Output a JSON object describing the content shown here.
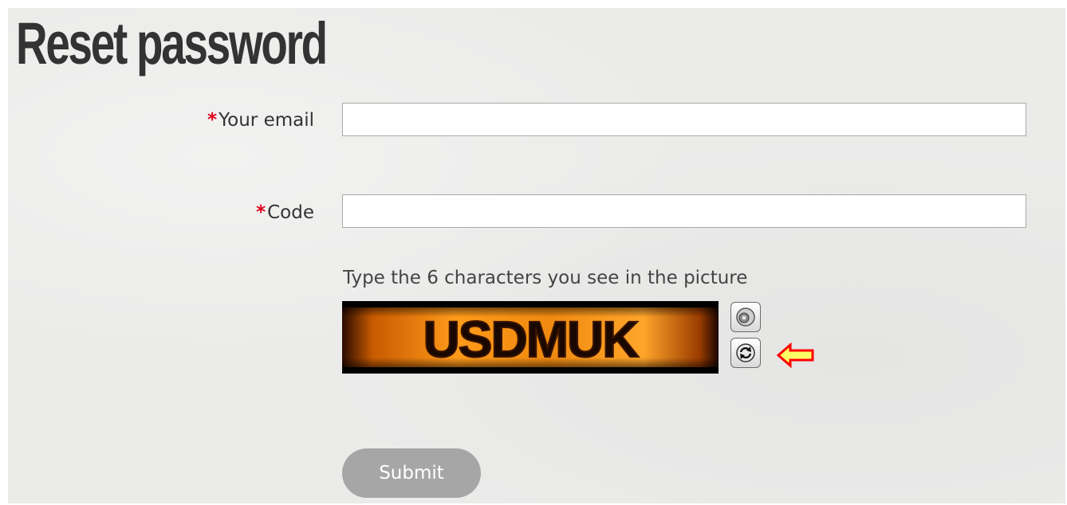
{
  "page": {
    "title": "Reset password"
  },
  "form": {
    "required_marker": "*",
    "email": {
      "label": "Your email",
      "value": "",
      "placeholder": ""
    },
    "code": {
      "label": "Code",
      "value": "",
      "placeholder": ""
    },
    "captcha": {
      "instruction": "Type the 6 characters you see in the picture",
      "image_text": "USDMUK",
      "audio_icon": "speaker-icon",
      "refresh_icon": "refresh-icon"
    },
    "submit_label": "Submit"
  },
  "annotation": {
    "arrow_icon": "left-arrow-icon",
    "arrow_color": "#ff0000",
    "arrow_fill": "#ffff66"
  }
}
